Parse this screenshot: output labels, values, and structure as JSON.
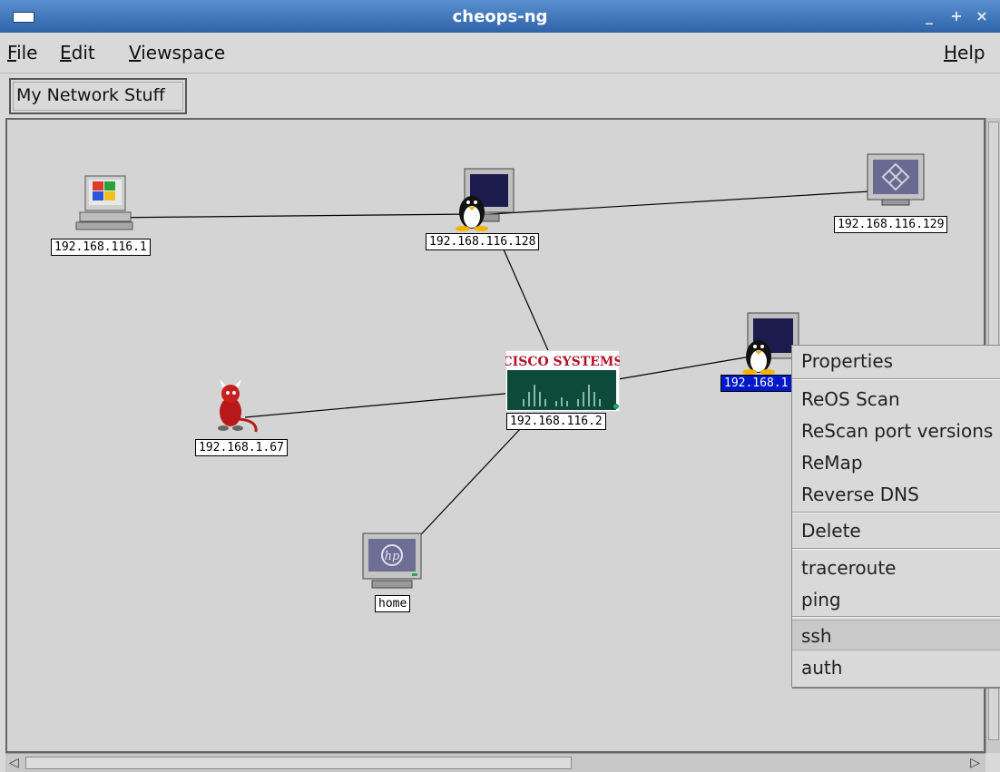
{
  "window": {
    "title": "cheops-ng"
  },
  "menubar": {
    "file": "File",
    "edit": "Edit",
    "viewspace": "Viewspace",
    "help": "Help"
  },
  "tabs": [
    {
      "label": "My Network Stuff"
    }
  ],
  "nodes": {
    "n1": {
      "label": "192.168.116.1",
      "icon": "windows-pc-icon"
    },
    "n2": {
      "label": "192.168.116.128",
      "icon": "linux-monitor-icon"
    },
    "n3": {
      "label": "192.168.116.129",
      "icon": "sun-monitor-icon"
    },
    "n4": {
      "label": "192.168.116.2",
      "icon": "cisco-router-icon",
      "brand": "CISCO SYSTEMS"
    },
    "n5": {
      "label": "192.168.1.67",
      "icon": "bsd-daemon-icon"
    },
    "n6": {
      "label": "192.168.1",
      "icon": "linux-monitor-icon",
      "selected": true
    },
    "n7": {
      "label": "home",
      "icon": "hp-monitor-icon"
    }
  },
  "context_menu": {
    "items": [
      "Properties",
      "ReOS Scan",
      "ReScan port versions",
      "ReMap",
      "Reverse DNS",
      "Delete",
      "traceroute",
      "ping",
      "ssh",
      "auth"
    ]
  },
  "colors": {
    "titlebar": "#3a72bb",
    "selection": "#0018c8",
    "cisco_red": "#b3122c",
    "cisco_green": "#0e4a3a"
  }
}
